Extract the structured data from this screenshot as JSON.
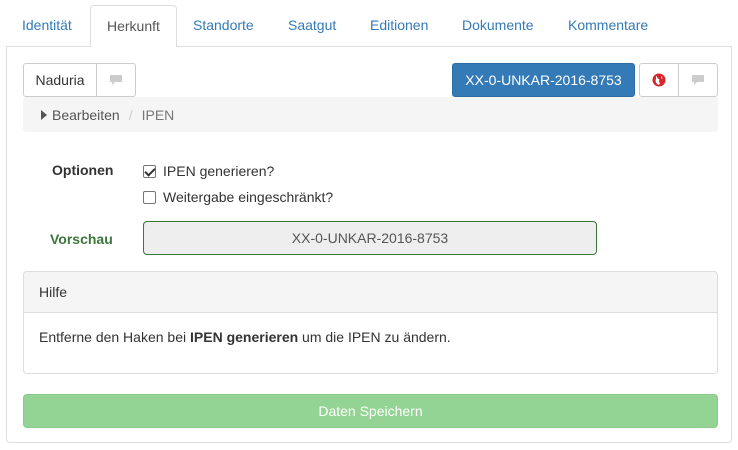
{
  "tabs": [
    {
      "label": "Identität"
    },
    {
      "label": "Herkunft",
      "active": true
    },
    {
      "label": "Standorte"
    },
    {
      "label": "Saatgut"
    },
    {
      "label": "Editionen"
    },
    {
      "label": "Dokumente"
    },
    {
      "label": "Kommentare"
    }
  ],
  "toolbar": {
    "left_button_label": "Naduria",
    "id_button_label": "XX-0-UNKAR-2016-8753",
    "icons": [
      "chat-icon",
      "globe-icon",
      "chat-icon"
    ]
  },
  "breadcrumb": {
    "items": [
      "Bearbeiten",
      "IPEN"
    ]
  },
  "form": {
    "options_label": "Optionen",
    "option_generate": {
      "label": "IPEN generieren?",
      "checked": true
    },
    "option_restricted": {
      "label": "Weitergabe eingeschränkt?",
      "checked": false
    },
    "preview_label": "Vorschau",
    "preview_value": "XX-0-UNKAR-2016-8753"
  },
  "help": {
    "title": "Hilfe",
    "text_before": "Entferne den Haken bei ",
    "text_bold": "IPEN generieren",
    "text_after": " um die IPEN zu ändern."
  },
  "save_button_label": "Daten Speichern",
  "colors": {
    "primary": "#337ab7",
    "success_text": "#3c763d",
    "save_button": "#93d393",
    "tab_link": "#337ab7"
  }
}
